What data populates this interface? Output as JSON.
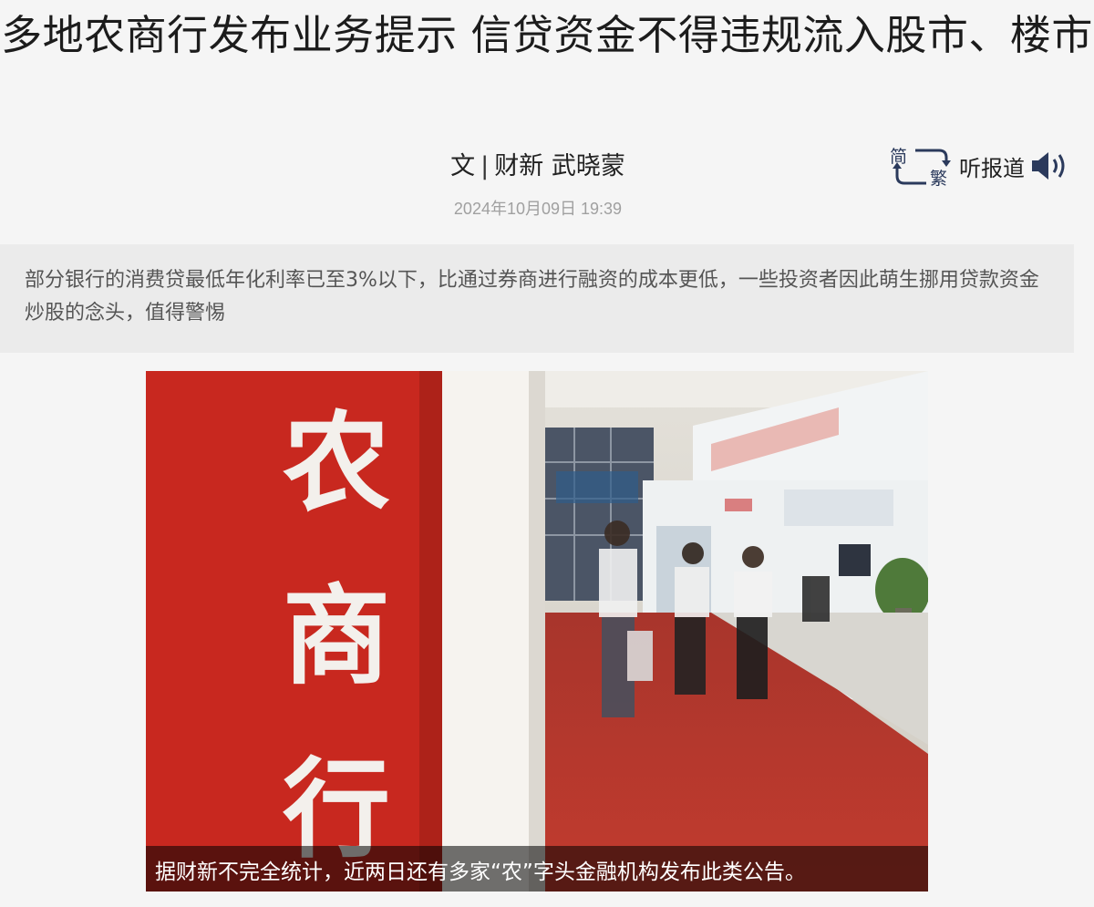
{
  "article": {
    "title": "多地农商行发布业务提示 信贷资金不得违规流入股市、楼市",
    "byline_prefix": "文",
    "byline_separator": "|",
    "byline_author": "财新 武晓蒙",
    "date": "2024年10月09日 19:39",
    "summary": "部分银行的消费贷最低年化利率已至3%以下，比通过券商进行融资的成本更低，一些投资者因此萌生挪用贷款资金炒股的念头，值得警惕"
  },
  "toolbar": {
    "convert_simplified": "简",
    "convert_traditional": "繁",
    "listen_label": "听报道",
    "listen_icon": "speaker-icon"
  },
  "photo": {
    "sign_chars": [
      "农",
      "商",
      "行"
    ],
    "caption": "据财新不完全统计，近两日还有多家“农”字头金融机构发布此类公告。"
  },
  "colors": {
    "background": "#f5f5f5",
    "summary_bg": "#ebebeb",
    "icon_navy": "#2b3a5c",
    "sign_red": "#c8281f",
    "carpet_red": "#b8342a"
  }
}
